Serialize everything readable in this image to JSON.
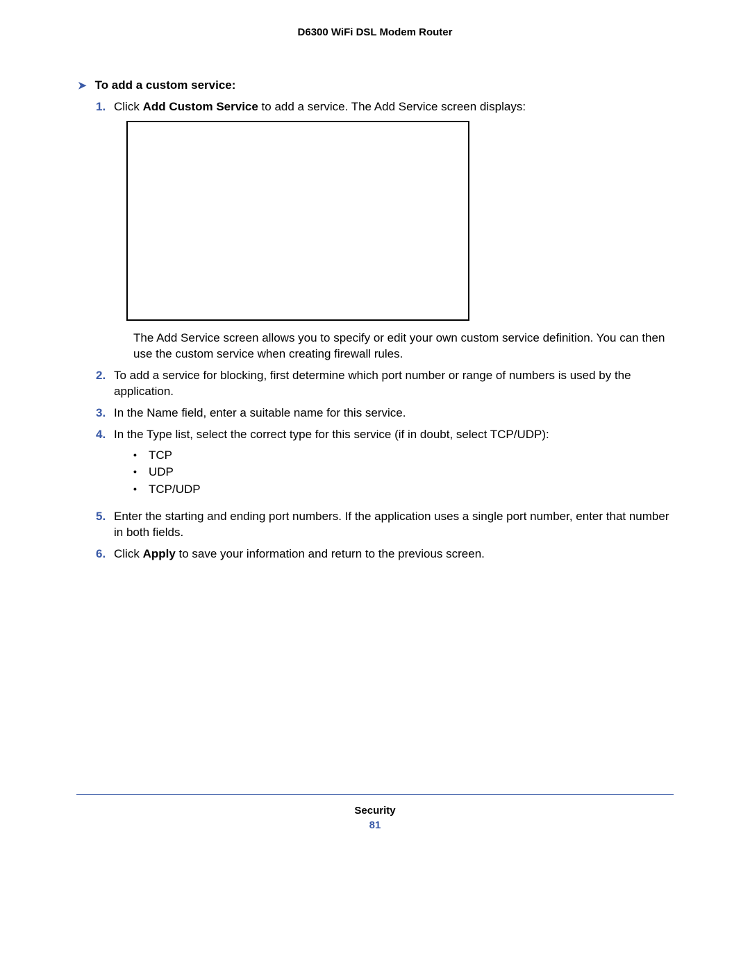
{
  "header": {
    "title": "D6300 WiFi DSL Modem Router"
  },
  "section": {
    "heading": "To add a custom service:"
  },
  "steps": {
    "s1": {
      "num": "1.",
      "pre": "Click ",
      "bold": "Add Custom Service",
      "post": " to add a service. The Add Service screen displays:",
      "followup": "The Add Service screen allows you to specify or edit your own custom service definition. You can then use the custom service when creating firewall rules."
    },
    "s2": {
      "num": "2.",
      "text": "To add a service for blocking, first determine which port number or range of numbers is used by the application."
    },
    "s3": {
      "num": "3.",
      "text": "In the Name field, enter a suitable name for this service."
    },
    "s4": {
      "num": "4.",
      "text": "In the Type list, select the correct type for this service (if in doubt, select TCP/UDP):",
      "items": {
        "a": "TCP",
        "b": "UDP",
        "c": "TCP/UDP"
      }
    },
    "s5": {
      "num": "5.",
      "text": "Enter the starting and ending port numbers. If the application uses a single port number, enter that number in both fields."
    },
    "s6": {
      "num": "6.",
      "pre": "Click ",
      "bold": "Apply",
      "post": " to save your information and return to the previous screen."
    }
  },
  "footer": {
    "section": "Security",
    "page": "81"
  }
}
